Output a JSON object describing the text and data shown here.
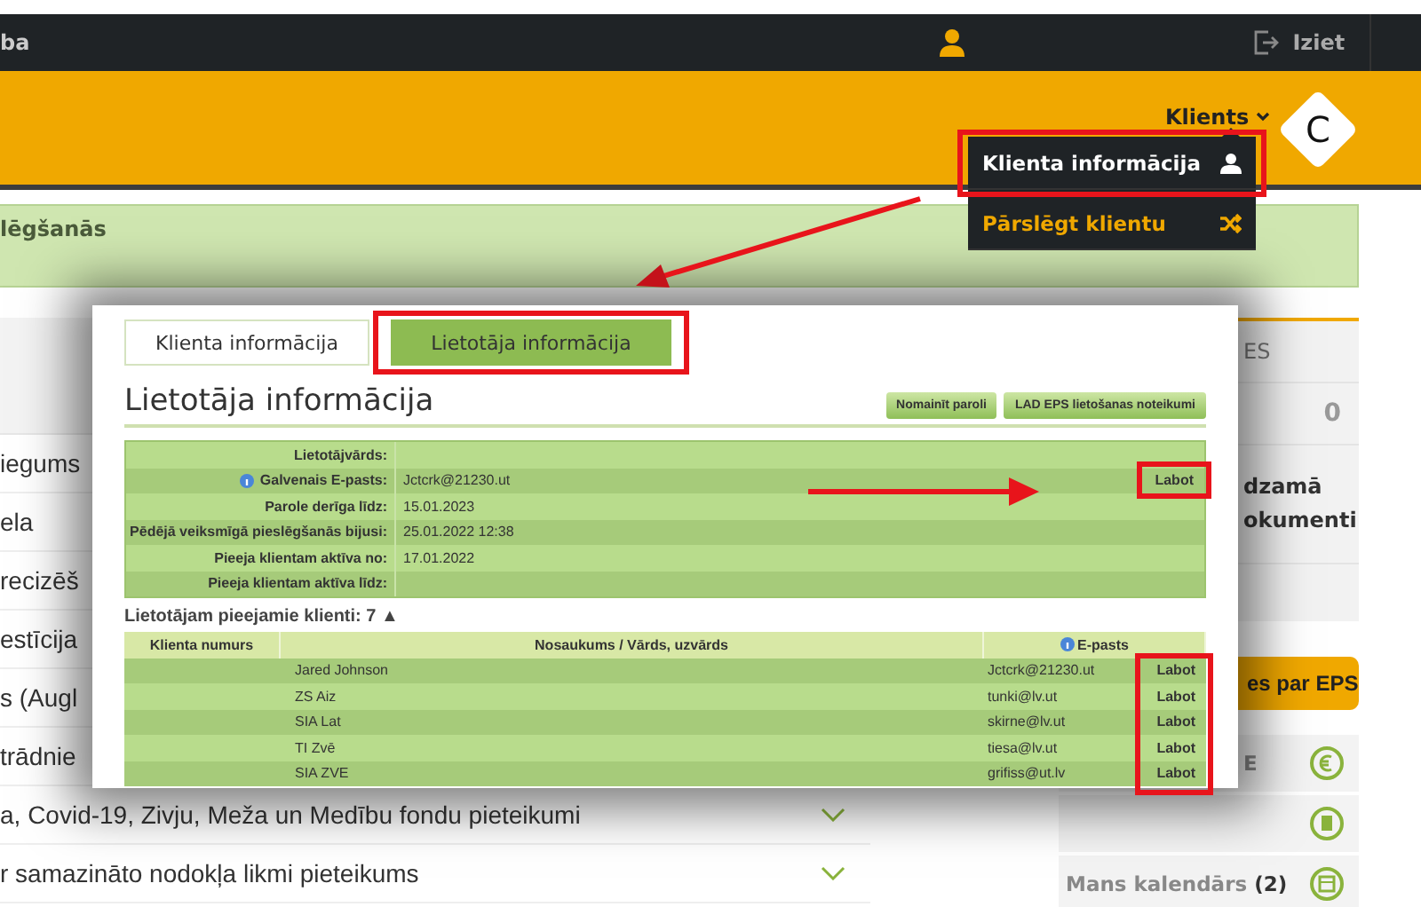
{
  "top_bar": {
    "left_text": "ba",
    "logout": "Iziet"
  },
  "header": {
    "menu": "Klients",
    "logo": "C"
  },
  "dropdown": {
    "items": [
      {
        "label": "Klienta informācija",
        "kind": "user",
        "selected": true
      },
      {
        "label": "Pārslēgt klientu",
        "kind": "shuffle",
        "selected": false
      }
    ]
  },
  "notice": {
    "text": "lēgšanās"
  },
  "left_list": {
    "items": [
      {
        "text": "iegums"
      },
      {
        "text": "ela"
      },
      {
        "text": "recizēš"
      },
      {
        "text": "estīcija"
      },
      {
        "text": "s (Augl"
      },
      {
        "text": "trādnie"
      },
      {
        "text": "a, Covid-19, Zivju, Meža un Medību fondu pieteikumi"
      },
      {
        "text": "r samazināto nodokļa likmi pieteikums"
      }
    ]
  },
  "right_panel": {
    "title": "ES",
    "count": "0",
    "heading_lines": [
      "dzamā",
      "okumenti"
    ],
    "button": "es par EPS",
    "items": [
      {
        "kind": "euro",
        "label": "E"
      },
      {
        "kind": "document"
      },
      {
        "kind": "calendar",
        "label": "Mans kalendārs",
        "count": "(2)"
      }
    ]
  },
  "popup": {
    "tabs": [
      {
        "label": "Klienta informācija",
        "selected": false
      },
      {
        "label": "Lietotāja informācija",
        "selected": true
      }
    ],
    "title": "Lietotāja informācija",
    "buttons": [
      "Nomainīt paroli",
      "LAD EPS lietošanas noteikumi"
    ],
    "info_rows": [
      {
        "label": "Lietotājvārds:",
        "info": false
      },
      {
        "label": "Galvenais E-pasts:",
        "value": "Jctcrk@21230.ut",
        "action": "Labot",
        "info": true
      },
      {
        "label": "Parole derīga līdz:",
        "value": "15.01.2023",
        "info": false
      },
      {
        "label": "Pēdējā veiksmīgā pieslēgšanās bijusi:",
        "value": "25.01.2022 12:38",
        "info": false
      },
      {
        "label": "Pieeja klientam aktīva no:",
        "value": "17.01.2022",
        "info": false
      },
      {
        "label": "Pieeja klientam aktīva līdz:",
        "info": false
      }
    ],
    "clients_heading": "Lietotājam pieejamie klienti: 7 ▲",
    "clients_table": {
      "columns": [
        {
          "label": "Klienta numurs",
          "info": false
        },
        {
          "label": "Nosaukums / Vārds, uzvārds",
          "info": false
        },
        {
          "label": "E-pasts",
          "info": true
        }
      ],
      "rows": [
        {
          "name": "Jared Johnson",
          "email": "Jctcrk@21230.ut",
          "action": "Labot"
        },
        {
          "name": "ZS Aiz",
          "email": "tunki@lv.ut",
          "action": "Labot"
        },
        {
          "name": "SIA Lat",
          "email": "skirne@lv.ut",
          "action": "Labot"
        },
        {
          "name": "TI Zvē",
          "email": "tiesa@lv.ut",
          "action": "Labot"
        },
        {
          "name": "SIA ZVE",
          "email": "grifiss@ut.lv",
          "action": "Labot"
        }
      ]
    }
  }
}
